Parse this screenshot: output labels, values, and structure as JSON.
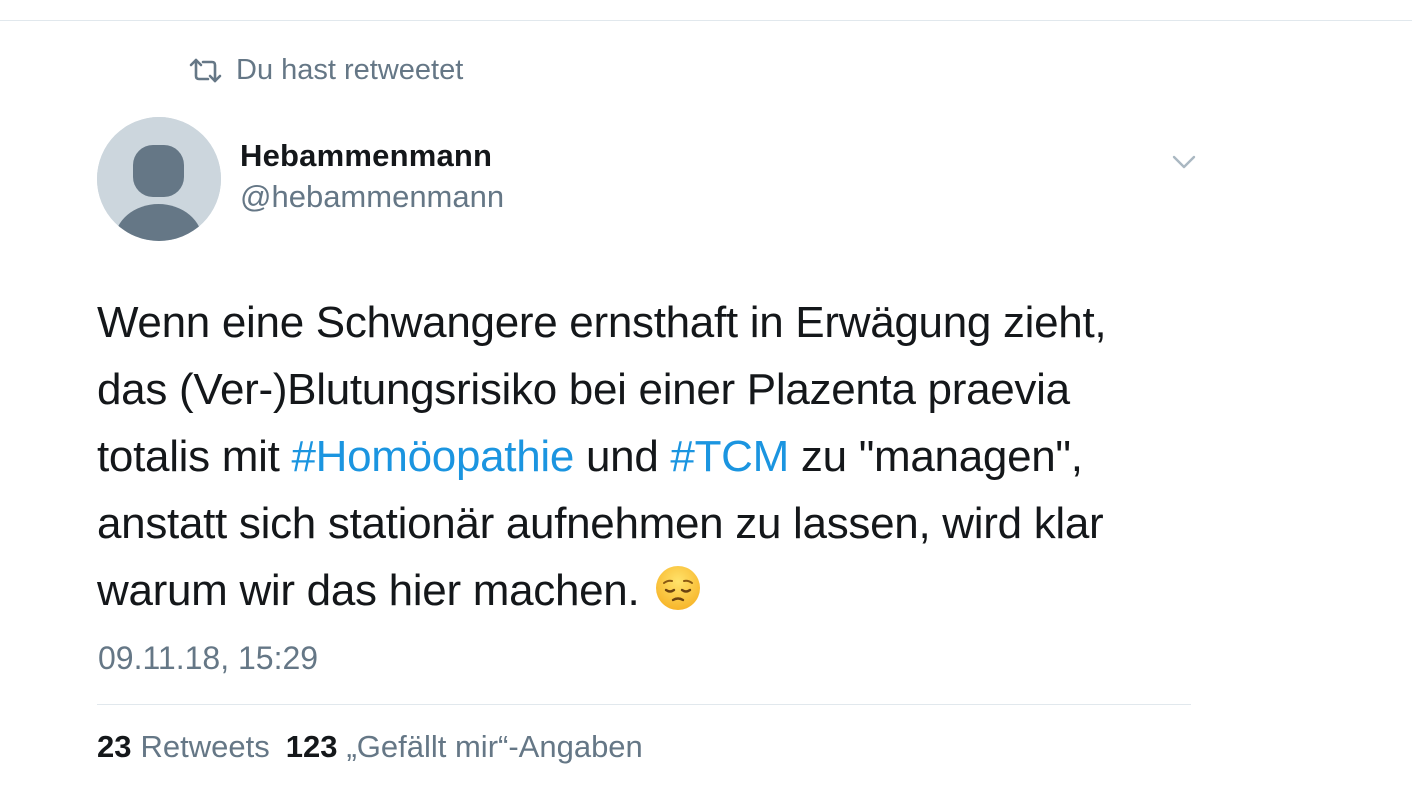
{
  "retweet_context": {
    "label": "Du hast retweetet",
    "icon": "retweet-icon"
  },
  "author": {
    "display_name": "Hebammenmann",
    "handle": "@hebammenmann",
    "avatar": "default-profile-avatar"
  },
  "menu": {
    "icon": "chevron-down-icon"
  },
  "tweet": {
    "lines": [
      [
        {
          "text": "Wenn eine Schwangere ernsthaft in Erwägung zieht,"
        }
      ],
      [
        {
          "text": "das (Ver-)Blutungsrisiko bei einer Plazenta praevia"
        }
      ],
      [
        {
          "text": "totalis mit "
        },
        {
          "text": "#Homöopathie",
          "hashtag": true
        },
        {
          "text": " und "
        },
        {
          "text": "#TCM",
          "hashtag": true
        },
        {
          "text": " zu \"managen\","
        }
      ],
      [
        {
          "text": "anstatt sich stationär aufnehmen zu lassen, wird klar"
        }
      ],
      [
        {
          "text": "warum wir das hier machen."
        }
      ]
    ],
    "emoji": "pensive-face-emoji",
    "timestamp": "09.11.18, 15:29"
  },
  "stats": {
    "retweets_count": "23",
    "retweets_label": "Retweets",
    "likes_count": "123",
    "likes_label": "„Gefällt mir“-Angaben"
  },
  "colors": {
    "hashtag": "#1b95e0",
    "secondary_text": "#657786",
    "primary_text": "#14171a",
    "divider": "#e1e8ed",
    "avatar_bg": "#ccd6dd",
    "avatar_fg": "#657786"
  }
}
